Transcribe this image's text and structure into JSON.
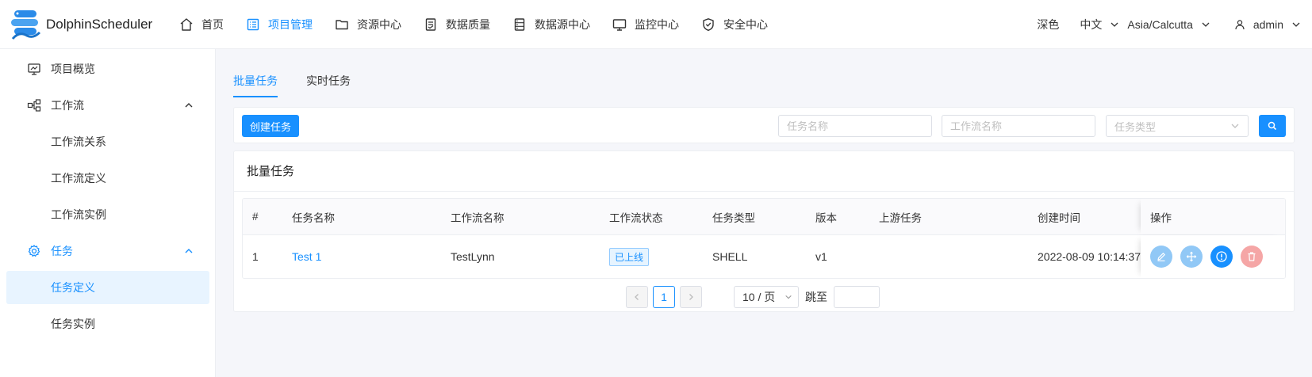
{
  "header": {
    "logo_text": "DolphinScheduler",
    "nav": [
      {
        "label": "首页",
        "icon": "home-icon"
      },
      {
        "label": "项目管理",
        "icon": "list-icon",
        "active": true
      },
      {
        "label": "资源中心",
        "icon": "folder-icon"
      },
      {
        "label": "数据质量",
        "icon": "document-icon"
      },
      {
        "label": "数据源中心",
        "icon": "database-icon"
      },
      {
        "label": "监控中心",
        "icon": "monitor-icon"
      },
      {
        "label": "安全中心",
        "icon": "shield-icon"
      }
    ],
    "theme_label": "深色",
    "language": "中文",
    "timezone": "Asia/Calcutta",
    "user": "admin"
  },
  "sidebar": {
    "items": [
      {
        "label": "项目概览",
        "icon": "overview-icon"
      },
      {
        "label": "工作流",
        "icon": "workflow-icon",
        "expanded": true
      },
      {
        "label": "工作流关系"
      },
      {
        "label": "工作流定义"
      },
      {
        "label": "工作流实例"
      },
      {
        "label": "任务",
        "icon": "gear-icon",
        "expanded": true,
        "active": true
      },
      {
        "label": "任务定义",
        "selected": true
      },
      {
        "label": "任务实例"
      }
    ]
  },
  "tabs": [
    {
      "label": "批量任务",
      "active": true
    },
    {
      "label": "实时任务"
    }
  ],
  "toolbar": {
    "create_label": "创建任务",
    "task_name_placeholder": "任务名称",
    "workflow_name_placeholder": "工作流名称",
    "task_type_placeholder": "任务类型"
  },
  "card": {
    "title": "批量任务"
  },
  "table": {
    "columns": [
      "#",
      "任务名称",
      "工作流名称",
      "工作流状态",
      "任务类型",
      "版本",
      "上游任务",
      "创建时间",
      "操作"
    ],
    "rows": [
      {
        "index": "1",
        "task_name": "Test 1",
        "workflow_name": "TestLynn",
        "workflow_status": "已上线",
        "task_type": "SHELL",
        "version": "v1",
        "upstream": "",
        "created_at": "2022-08-09 10:14:37"
      }
    ]
  },
  "pagination": {
    "current_page": "1",
    "page_size_label": "10 / 页",
    "jump_label": "跳至"
  },
  "colors": {
    "primary": "#1890ff",
    "op_edit": "#91c8f6",
    "op_move": "#91c8f6",
    "op_version": "#1890ff",
    "op_delete": "#f5a6a6"
  }
}
